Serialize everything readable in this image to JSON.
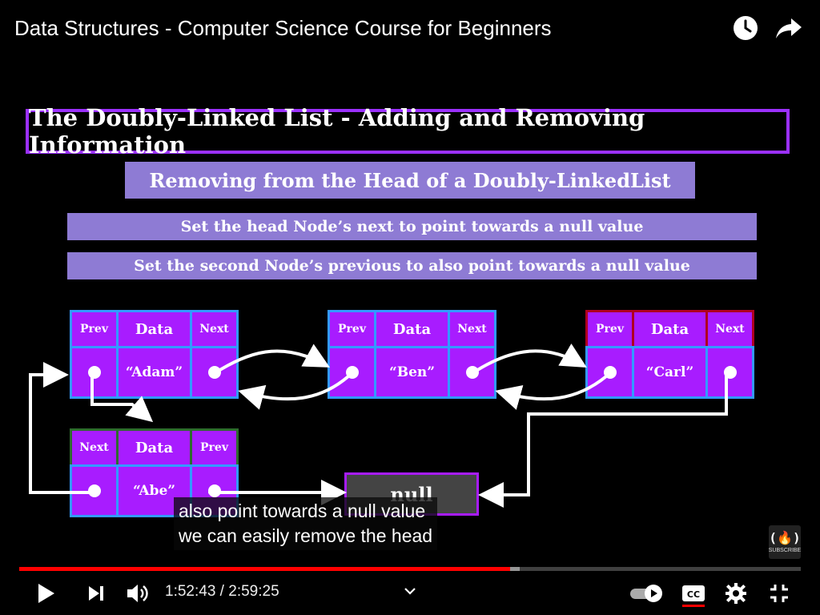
{
  "header": {
    "title": "Data Structures - Computer Science Course for Beginners",
    "icons": [
      "watch-later-icon",
      "share-icon"
    ]
  },
  "slide": {
    "main_heading": "The Doubly-Linked List - Adding and Removing Information",
    "sub_heading": "Removing from the Head of a Doubly-LinkedList",
    "step1": "Set the head Node’s next to point towards a null value",
    "step2": "Set the second Node’s previous to also point towards a null value",
    "nodes": {
      "adam": {
        "left": "Prev",
        "mid": "Data",
        "right": "Next",
        "value": "“Adam”"
      },
      "ben": {
        "left": "Prev",
        "mid": "Data",
        "right": "Next",
        "value": "“Ben”"
      },
      "carl": {
        "left": "Prev",
        "mid": "Data",
        "right": "Next",
        "value": "“Carl”"
      },
      "abe": {
        "left": "Next",
        "mid": "Data",
        "right": "Prev",
        "value": "“Abe”"
      }
    },
    "null_label": "null",
    "colors": {
      "node": "#a81cff",
      "node_border": "#3399ff",
      "carl_border": "#b00020",
      "abe_border": "#2e6b2e",
      "bar": "#8e7bd4",
      "heading_border": "#9b30ff"
    }
  },
  "captions": {
    "line1": "also point towards a null value",
    "line2": "we can easily remove the head"
  },
  "branding": {
    "label": "SUBSCRIBE"
  },
  "player": {
    "current_time": "1:52:43",
    "separator": " / ",
    "duration": "2:59:25",
    "played_fraction": 0.628,
    "buffered_fraction": 0.64,
    "progress_color": "#ff0000",
    "autoplay_on": true,
    "captions_on": true
  }
}
